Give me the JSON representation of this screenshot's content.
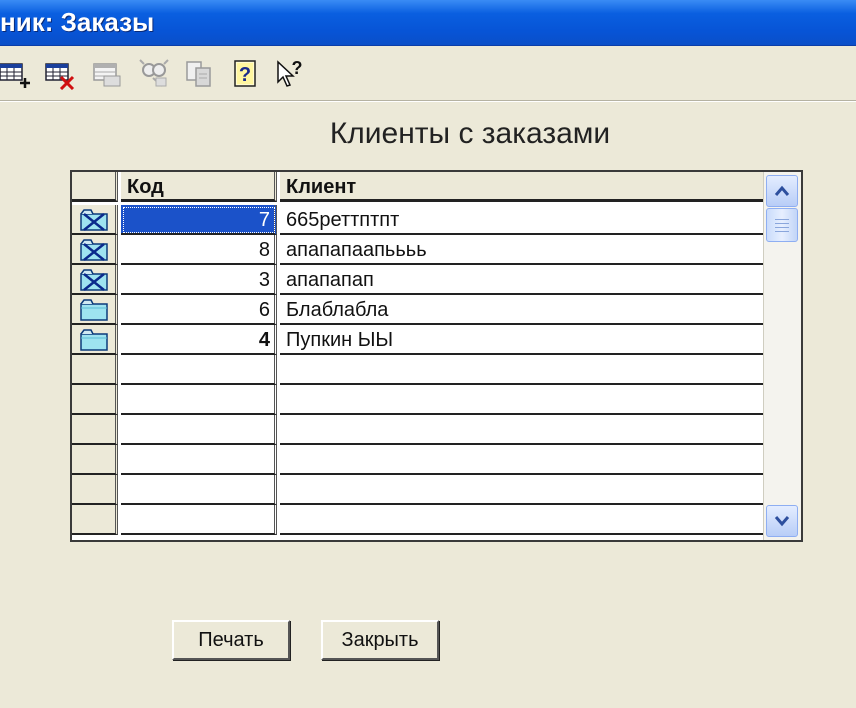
{
  "window": {
    "title": "ник: Заказы"
  },
  "toolbar": {
    "buttons": [
      {
        "icon": "add-record-icon"
      },
      {
        "icon": "delete-record-icon"
      },
      {
        "icon": "edit-record-icon"
      },
      {
        "icon": "find-icon"
      },
      {
        "icon": "copy-icon"
      },
      {
        "icon": "help-icon"
      },
      {
        "icon": "whats-this-icon",
        "label": "?"
      }
    ],
    "help_label": "?"
  },
  "page": {
    "heading": "Клиенты с заказами"
  },
  "grid": {
    "columns": [
      "Код",
      "Клиент"
    ],
    "rows": [
      {
        "kod": "7",
        "client": "665реттптпт",
        "icon": "deleted-folder-icon",
        "selected": true
      },
      {
        "kod": "8",
        "client": "апапапаапьььь",
        "icon": "deleted-folder-icon"
      },
      {
        "kod": "3",
        "client": "апапапап",
        "icon": "deleted-folder-icon"
      },
      {
        "kod": "6",
        "client": "Блаблабла",
        "icon": "folder-icon"
      },
      {
        "kod": "4",
        "client": "Пупкин ЫЫ",
        "icon": "folder-icon",
        "bold": true
      },
      {
        "kod": "",
        "client": ""
      },
      {
        "kod": "",
        "client": ""
      },
      {
        "kod": "",
        "client": ""
      },
      {
        "kod": "",
        "client": ""
      },
      {
        "kod": "",
        "client": ""
      },
      {
        "kod": "",
        "client": ""
      }
    ]
  },
  "buttons": {
    "print": "Печать",
    "close": "Закрыть"
  },
  "colors": {
    "titlebar": "#0754d6",
    "selection": "#1b52c9",
    "face": "#ece9d8"
  }
}
